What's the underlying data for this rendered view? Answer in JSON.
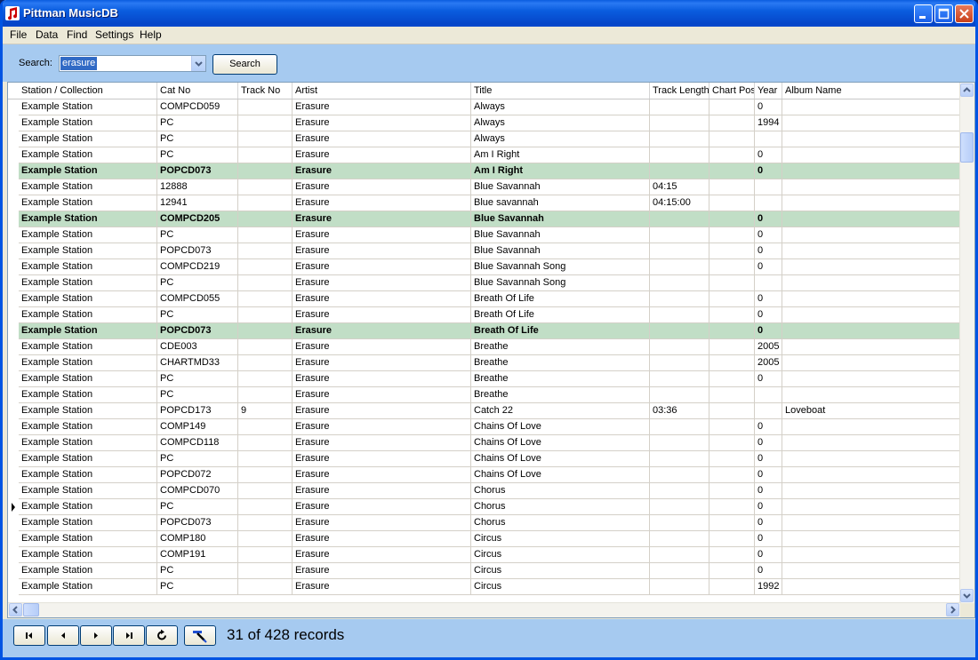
{
  "window": {
    "title": "Pittman MusicDB"
  },
  "menu": [
    "File",
    "Data",
    "Find",
    "Settings",
    "Help"
  ],
  "search": {
    "label": "Search:",
    "value": "erasure",
    "button": "Search"
  },
  "columns": [
    "Station / Collection",
    "Cat No",
    "Track No",
    "Artist",
    "Title",
    "Track Length",
    "Chart Posi",
    "Year",
    "Album Name"
  ],
  "rows": [
    {
      "station": "Example Station",
      "cat": "COMPCD059",
      "track": "",
      "artist": "Erasure",
      "title": "Always",
      "length": "",
      "chart": "",
      "year": "0",
      "album": "",
      "hl": false
    },
    {
      "station": "Example Station",
      "cat": "PC",
      "track": "",
      "artist": "Erasure",
      "title": "Always",
      "length": "",
      "chart": "",
      "year": "1994",
      "album": "",
      "hl": false
    },
    {
      "station": "Example Station",
      "cat": "PC",
      "track": "",
      "artist": "Erasure",
      "title": "Always",
      "length": "",
      "chart": "",
      "year": "",
      "album": "",
      "hl": false
    },
    {
      "station": "Example Station",
      "cat": "PC",
      "track": "",
      "artist": "Erasure",
      "title": "Am I Right",
      "length": "",
      "chart": "",
      "year": "0",
      "album": "",
      "hl": false
    },
    {
      "station": "Example Station",
      "cat": "POPCD073",
      "track": "",
      "artist": "Erasure",
      "title": "Am I Right",
      "length": "",
      "chart": "",
      "year": "0",
      "album": "",
      "hl": true
    },
    {
      "station": "Example Station",
      "cat": "12888",
      "track": "",
      "artist": "Erasure",
      "title": "Blue Savannah",
      "length": "04:15",
      "chart": "",
      "year": "",
      "album": "",
      "hl": false
    },
    {
      "station": "Example Station",
      "cat": "12941",
      "track": "",
      "artist": "Erasure",
      "title": "Blue savannah",
      "length": "04:15:00",
      "chart": "",
      "year": "",
      "album": "",
      "hl": false
    },
    {
      "station": "Example Station",
      "cat": "COMPCD205",
      "track": "",
      "artist": "Erasure",
      "title": "Blue Savannah",
      "length": "",
      "chart": "",
      "year": "0",
      "album": "",
      "hl": true
    },
    {
      "station": "Example Station",
      "cat": "PC",
      "track": "",
      "artist": "Erasure",
      "title": "Blue Savannah",
      "length": "",
      "chart": "",
      "year": "0",
      "album": "",
      "hl": false
    },
    {
      "station": "Example Station",
      "cat": "POPCD073",
      "track": "",
      "artist": "Erasure",
      "title": "Blue Savannah",
      "length": "",
      "chart": "",
      "year": "0",
      "album": "",
      "hl": false
    },
    {
      "station": "Example Station",
      "cat": "COMPCD219",
      "track": "",
      "artist": "Erasure",
      "title": "Blue Savannah Song",
      "length": "",
      "chart": "",
      "year": "0",
      "album": "",
      "hl": false
    },
    {
      "station": "Example Station",
      "cat": "PC",
      "track": "",
      "artist": "Erasure",
      "title": "Blue Savannah Song",
      "length": "",
      "chart": "",
      "year": "",
      "album": "",
      "hl": false
    },
    {
      "station": "Example Station",
      "cat": "COMPCD055",
      "track": "",
      "artist": "Erasure",
      "title": "Breath Of Life",
      "length": "",
      "chart": "",
      "year": "0",
      "album": "",
      "hl": false
    },
    {
      "station": "Example Station",
      "cat": "PC",
      "track": "",
      "artist": "Erasure",
      "title": "Breath Of Life",
      "length": "",
      "chart": "",
      "year": "0",
      "album": "",
      "hl": false
    },
    {
      "station": "Example Station",
      "cat": "POPCD073",
      "track": "",
      "artist": "Erasure",
      "title": "Breath Of Life",
      "length": "",
      "chart": "",
      "year": "0",
      "album": "",
      "hl": true
    },
    {
      "station": "Example Station",
      "cat": "CDE003",
      "track": "",
      "artist": "Erasure",
      "title": "Breathe",
      "length": "",
      "chart": "",
      "year": "2005",
      "album": "",
      "hl": false
    },
    {
      "station": "Example Station",
      "cat": "CHARTMD33",
      "track": "",
      "artist": "Erasure",
      "title": "Breathe",
      "length": "",
      "chart": "",
      "year": "2005",
      "album": "",
      "hl": false
    },
    {
      "station": "Example Station",
      "cat": "PC",
      "track": "",
      "artist": "Erasure",
      "title": "Breathe",
      "length": "",
      "chart": "",
      "year": "0",
      "album": "",
      "hl": false
    },
    {
      "station": "Example Station",
      "cat": "PC",
      "track": "",
      "artist": "Erasure",
      "title": "Breathe",
      "length": "",
      "chart": "",
      "year": "",
      "album": "",
      "hl": false
    },
    {
      "station": "Example Station",
      "cat": "POPCD173",
      "track": "9",
      "artist": "Erasure",
      "title": "Catch 22",
      "length": "03:36",
      "chart": "",
      "year": "",
      "album": "Loveboat",
      "hl": false
    },
    {
      "station": "Example Station",
      "cat": "COMP149",
      "track": "",
      "artist": "Erasure",
      "title": "Chains Of Love",
      "length": "",
      "chart": "",
      "year": "0",
      "album": "",
      "hl": false
    },
    {
      "station": "Example Station",
      "cat": "COMPCD118",
      "track": "",
      "artist": "Erasure",
      "title": "Chains Of Love",
      "length": "",
      "chart": "",
      "year": "0",
      "album": "",
      "hl": false
    },
    {
      "station": "Example Station",
      "cat": "PC",
      "track": "",
      "artist": "Erasure",
      "title": "Chains Of Love",
      "length": "",
      "chart": "",
      "year": "0",
      "album": "",
      "hl": false
    },
    {
      "station": "Example Station",
      "cat": "POPCD072",
      "track": "",
      "artist": "Erasure",
      "title": "Chains Of Love",
      "length": "",
      "chart": "",
      "year": "0",
      "album": "",
      "hl": false
    },
    {
      "station": "Example Station",
      "cat": "COMPCD070",
      "track": "",
      "artist": "Erasure",
      "title": "Chorus",
      "length": "",
      "chart": "",
      "year": "0",
      "album": "",
      "hl": false
    },
    {
      "station": "Example Station",
      "cat": "PC",
      "track": "",
      "artist": "Erasure",
      "title": "Chorus",
      "length": "",
      "chart": "",
      "year": "0",
      "album": "",
      "hl": false,
      "current": true
    },
    {
      "station": "Example Station",
      "cat": "POPCD073",
      "track": "",
      "artist": "Erasure",
      "title": "Chorus",
      "length": "",
      "chart": "",
      "year": "0",
      "album": "",
      "hl": false
    },
    {
      "station": "Example Station",
      "cat": "COMP180",
      "track": "",
      "artist": "Erasure",
      "title": "Circus",
      "length": "",
      "chart": "",
      "year": "0",
      "album": "",
      "hl": false
    },
    {
      "station": "Example Station",
      "cat": "COMP191",
      "track": "",
      "artist": "Erasure",
      "title": "Circus",
      "length": "",
      "chart": "",
      "year": "0",
      "album": "",
      "hl": false
    },
    {
      "station": "Example Station",
      "cat": "PC",
      "track": "",
      "artist": "Erasure",
      "title": "Circus",
      "length": "",
      "chart": "",
      "year": "0",
      "album": "",
      "hl": false
    },
    {
      "station": "Example Station",
      "cat": "PC",
      "track": "",
      "artist": "Erasure",
      "title": "Circus",
      "length": "",
      "chart": "",
      "year": "1992",
      "album": "",
      "hl": false
    }
  ],
  "status": {
    "record_count": "31 of 428 records"
  },
  "icons": {
    "app": "music-note-icon",
    "nav": [
      "first-record-icon",
      "previous-record-icon",
      "next-record-icon",
      "last-record-icon",
      "refresh-icon",
      "edit-record-icon"
    ]
  },
  "colors": {
    "titlebar": "#0a5ddf",
    "panel": "#a6caf0",
    "highlight_row": "#c1dec6"
  }
}
